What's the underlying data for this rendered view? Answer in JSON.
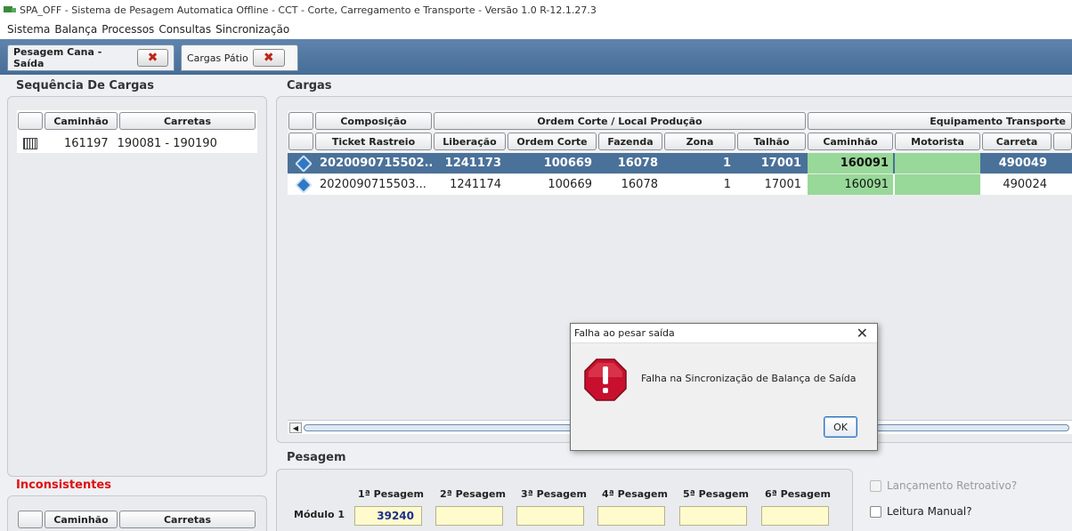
{
  "window": {
    "title": "SPA_OFF - Sistema de Pesagem Automatica Offline - CCT - Corte, Carregamento e Transporte - Versão 1.0 R-12.1.27.3"
  },
  "menu": [
    "Sistema",
    "Balança",
    "Processos",
    "Consultas",
    "Sincronização"
  ],
  "tabs": [
    {
      "label": "Pesagem Cana - Saída",
      "close": "✖"
    },
    {
      "label": "Cargas Pátio",
      "close": "✖"
    }
  ],
  "sequencia": {
    "title": "Sequência De Cargas",
    "headers": [
      "Caminhão",
      "Carretas"
    ],
    "rows": [
      {
        "icon": "barcode-icon",
        "caminhao": "161197",
        "carretas": "190081 - 190190"
      }
    ]
  },
  "inconsistentes": {
    "title": "Inconsistentes",
    "headers": [
      "Caminhão",
      "Carretas"
    ],
    "title_color": "#e01010"
  },
  "cargas": {
    "title": "Cargas",
    "group_headers": [
      "Composição",
      "Ordem Corte / Local Produção",
      "Equipamento Transporte"
    ],
    "headers": [
      "Ticket Rastreio",
      "Liberação",
      "Ordem Corte",
      "Fazenda",
      "Zona",
      "Talhão",
      "Caminhão",
      "Motorista",
      "Carreta"
    ],
    "rows": [
      {
        "ticket": "2020090715502...",
        "liberacao": "1241173",
        "ordem": "100669",
        "fazenda": "16078",
        "zona": "1",
        "talhao": "17001",
        "caminhao": "160091",
        "motorista": "",
        "carreta": "490049"
      },
      {
        "ticket": "2020090715503...",
        "liberacao": "1241174",
        "ordem": "100669",
        "fazenda": "16078",
        "zona": "1",
        "talhao": "17001",
        "caminhao": "160091",
        "motorista": "",
        "carreta": "490024"
      }
    ],
    "selected_color": "#4a7199",
    "highlight_color": "#98d898"
  },
  "pesagem": {
    "title": "Pesagem",
    "modulo": "Módulo 1",
    "columns": [
      "1ª Pesagem",
      "2ª Pesagem",
      "3ª Pesagem",
      "4ª Pesagem",
      "5ª Pesagem",
      "6ª Pesagem"
    ],
    "values": [
      "39240",
      "",
      "",
      "",
      "",
      ""
    ],
    "lancamento_retroativo": "Lançamento Retroativo?",
    "leitura_manual": "Leitura Manual?"
  },
  "dialog": {
    "title": "Falha ao pesar saída",
    "close": "✕",
    "message": "Falha na Sincronização de Balança de Saída",
    "ok": "OK",
    "icon": "error-stop-icon"
  }
}
